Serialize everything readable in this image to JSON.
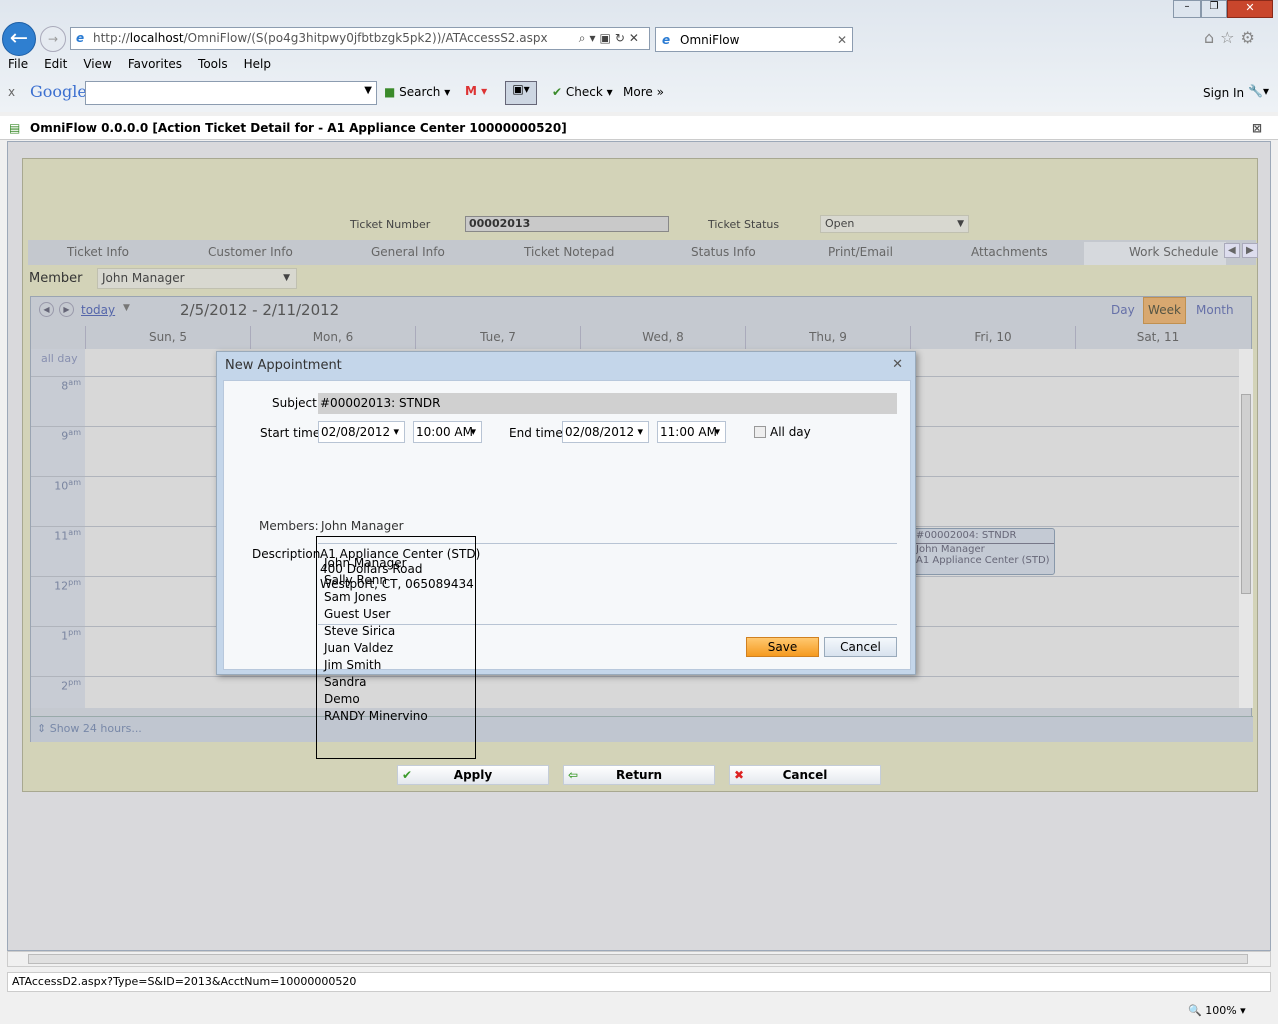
{
  "browser": {
    "url_host": "http://",
    "url_bold": "localhost",
    "url_rest": "/OmniFlow/(S(po4g3hitpwy0jfbtbzgk5pk2))/ATAccessS2.aspx",
    "tab_title": "OmniFlow",
    "menu": [
      "File",
      "Edit",
      "View",
      "Favorites",
      "Tools",
      "Help"
    ],
    "google": {
      "logo": "Google",
      "search": "Search",
      "check": "Check",
      "more": "More »",
      "sign_in": "Sign In"
    },
    "status_url": "ATAccessD2.aspx?Type=S&ID=2013&AcctNum=10000000520",
    "zoom": "100%"
  },
  "app": {
    "title": "OmniFlow 0.0.0.0 [Action Ticket Detail for - A1 Appliance Center 10000000520]",
    "ticket_number_label": "Ticket Number",
    "ticket_number": "00002013",
    "ticket_status_label": "Ticket Status",
    "ticket_status": "Open",
    "tabs": [
      "Ticket Info",
      "Customer Info",
      "General Info",
      "Ticket Notepad",
      "Status Info",
      "Print/Email",
      "Attachments",
      "Work Schedule"
    ],
    "active_tab": "Work Schedule",
    "member_label": "Member",
    "member": "John Manager"
  },
  "calendar": {
    "today": "today",
    "range": "2/5/2012 - 2/11/2012",
    "views": [
      "Day",
      "Week",
      "Month"
    ],
    "active_view": "Week",
    "days": [
      "Sun, 5",
      "Mon, 6",
      "Tue, 7",
      "Wed, 8",
      "Thu, 9",
      "Fri, 10",
      "Sat, 11"
    ],
    "all_day": "all day",
    "hours": [
      [
        "8",
        "am"
      ],
      [
        "9",
        "am"
      ],
      [
        "10",
        "am"
      ],
      [
        "11",
        "am"
      ],
      [
        "12",
        "pm"
      ],
      [
        "1",
        "pm"
      ],
      [
        "2",
        "pm"
      ]
    ],
    "show24": "Show 24 hours...",
    "event": {
      "title": "#00002004: STNDR",
      "line1": "John Manager",
      "line2": "A1 Appliance Center (STD)"
    }
  },
  "dialog": {
    "title": "New Appointment",
    "subject_label": "Subject",
    "subject": "#00002013: STNDR",
    "start_label": "Start time",
    "start_date": "02/08/2012",
    "start_time": "10:00 AM",
    "end_label": "End time",
    "end_date": "02/08/2012",
    "end_time": "11:00 AM",
    "allday_label": "All day",
    "allday": false,
    "members_label": "Members:",
    "members": "John Manager",
    "desc_label": "Description",
    "desc_lines": [
      "A1 Appliance Center (STD)",
      "400 Dollars Road",
      "Westport, CT, 065089434"
    ],
    "save": "Save",
    "cancel": "Cancel"
  },
  "member_list": [
    "John Manager",
    "Sally Renn",
    "Sam Jones",
    "Guest User",
    "Steve Sirica",
    "Juan Valdez",
    "Jim Smith",
    "Sandra",
    "Demo",
    "RANDY Minervino"
  ],
  "actions": {
    "apply": "Apply",
    "return": "Return",
    "cancel": "Cancel"
  }
}
